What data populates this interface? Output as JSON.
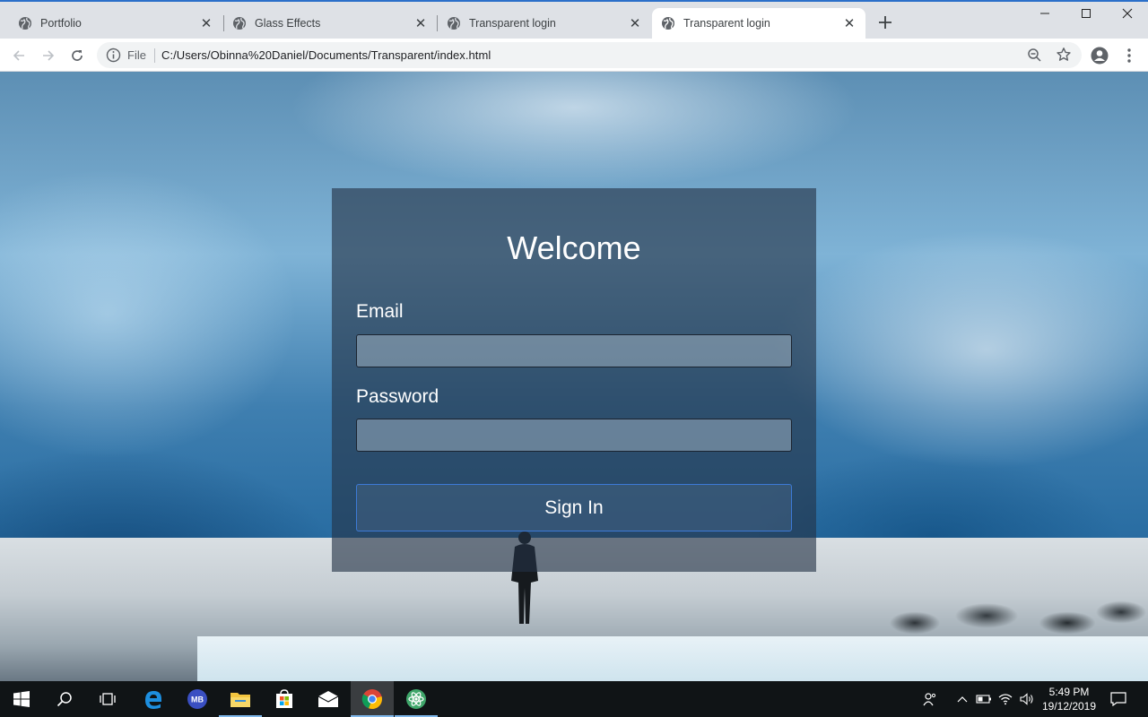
{
  "browser": {
    "tabs": [
      {
        "title": "Portfolio",
        "active": false
      },
      {
        "title": "Glass Effects",
        "active": false
      },
      {
        "title": "Transparent login",
        "active": false
      },
      {
        "title": "Transparent login",
        "active": true
      }
    ],
    "new_tab_icon": "plus-icon",
    "window_controls": [
      "minimize-icon",
      "maximize-icon",
      "close-icon"
    ],
    "address_bar": {
      "scheme_label": "File",
      "url": "C:/Users/Obinna%20Daniel/Documents/Transparent/index.html"
    }
  },
  "login": {
    "title": "Welcome",
    "email_label": "Email",
    "email_value": "",
    "password_label": "Password",
    "password_value": "",
    "submit_label": "Sign In"
  },
  "taskbar": {
    "pinned": [
      "windows-start-icon",
      "search-icon",
      "task-view-icon",
      "edge-icon",
      "mb-app-icon",
      "file-explorer-icon",
      "store-icon",
      "mail-icon",
      "chrome-icon",
      "atom-icon"
    ],
    "active_app": "chrome-icon",
    "clock": {
      "time": "5:49 PM",
      "date": "19/12/2019"
    }
  },
  "colors": {
    "tab_strip": "#dee1e6",
    "card_overlay": "#233246",
    "button_border": "#3d7ad6",
    "taskbar": "#101416"
  }
}
